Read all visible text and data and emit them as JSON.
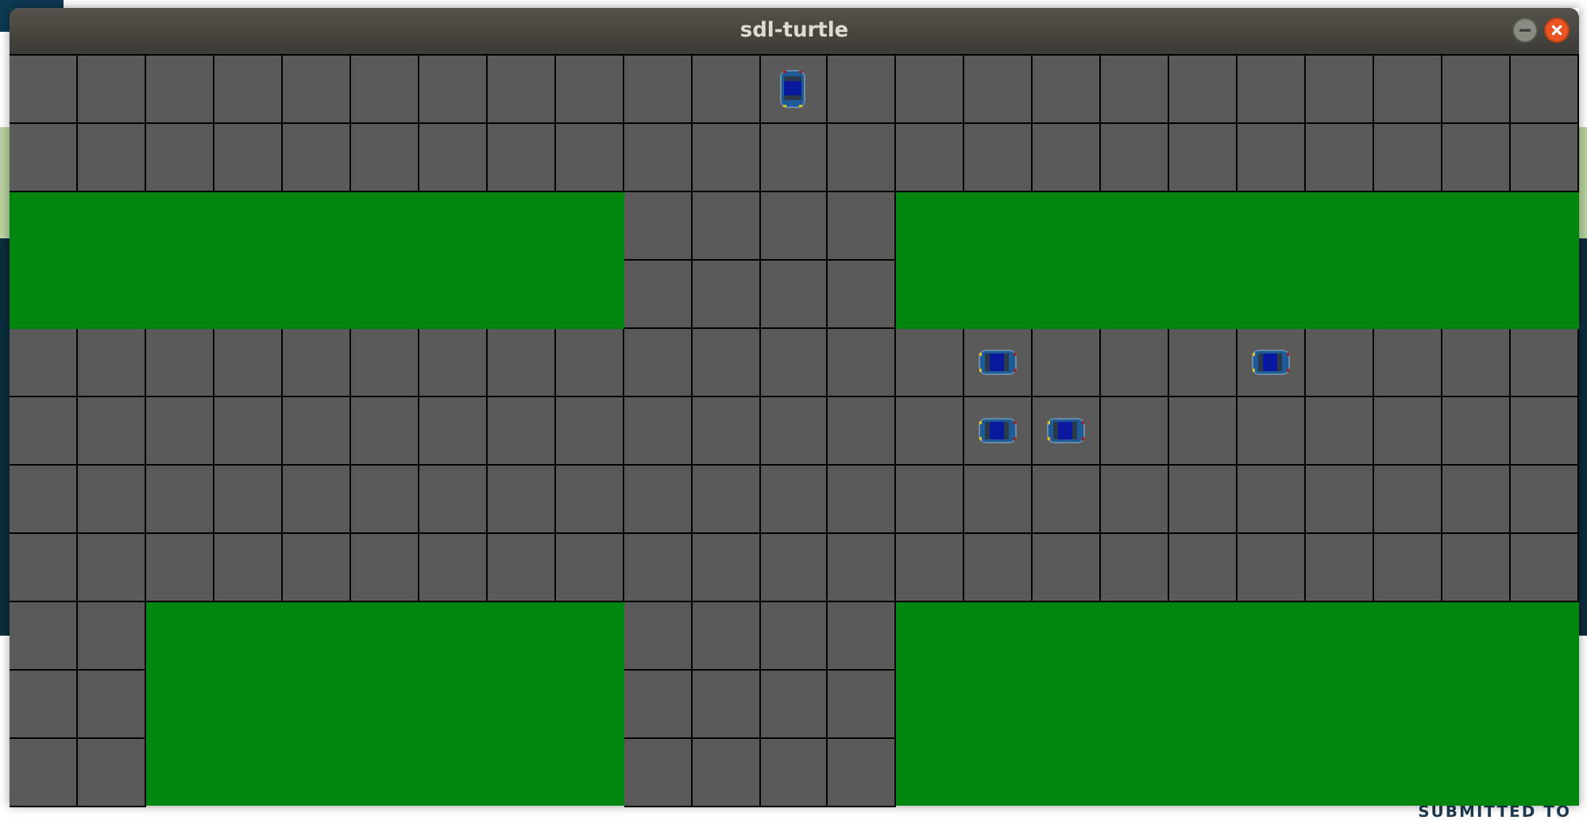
{
  "background_page": {
    "footer_label": "SUBMITTED TO"
  },
  "window": {
    "title": "sdl-turtle",
    "grid": [
      {
        "cells": [
          {
            "kind": "road"
          },
          {
            "kind": "road"
          },
          {
            "kind": "road"
          },
          {
            "kind": "road"
          },
          {
            "kind": "road"
          },
          {
            "kind": "road"
          },
          {
            "kind": "road"
          },
          {
            "kind": "road"
          },
          {
            "kind": "road"
          },
          {
            "kind": "road"
          },
          {
            "kind": "road"
          },
          {
            "kind": "car-up"
          },
          {
            "kind": "road"
          },
          {
            "kind": "road"
          },
          {
            "kind": "road"
          },
          {
            "kind": "road"
          },
          {
            "kind": "road"
          },
          {
            "kind": "road"
          },
          {
            "kind": "road"
          },
          {
            "kind": "road"
          },
          {
            "kind": "road"
          },
          {
            "kind": "road"
          },
          {
            "kind": "road"
          }
        ]
      },
      {
        "cells": [
          {
            "kind": "road"
          },
          {
            "kind": "road"
          },
          {
            "kind": "road"
          },
          {
            "kind": "road"
          },
          {
            "kind": "road"
          },
          {
            "kind": "road"
          },
          {
            "kind": "road"
          },
          {
            "kind": "road"
          },
          {
            "kind": "road"
          },
          {
            "kind": "road"
          },
          {
            "kind": "road"
          },
          {
            "kind": "road"
          },
          {
            "kind": "road"
          },
          {
            "kind": "road"
          },
          {
            "kind": "road"
          },
          {
            "kind": "road"
          },
          {
            "kind": "road"
          },
          {
            "kind": "road"
          },
          {
            "kind": "road"
          },
          {
            "kind": "road"
          },
          {
            "kind": "road"
          },
          {
            "kind": "road"
          },
          {
            "kind": "road"
          }
        ]
      },
      {
        "cells": [
          {
            "kind": "grass"
          },
          {
            "kind": "grass"
          },
          {
            "kind": "grass"
          },
          {
            "kind": "grass"
          },
          {
            "kind": "grass"
          },
          {
            "kind": "grass"
          },
          {
            "kind": "grass"
          },
          {
            "kind": "grass"
          },
          {
            "kind": "grass"
          },
          {
            "kind": "road"
          },
          {
            "kind": "road"
          },
          {
            "kind": "road"
          },
          {
            "kind": "road"
          },
          {
            "kind": "grass"
          },
          {
            "kind": "grass"
          },
          {
            "kind": "grass"
          },
          {
            "kind": "grass"
          },
          {
            "kind": "grass"
          },
          {
            "kind": "grass"
          },
          {
            "kind": "grass"
          },
          {
            "kind": "grass"
          },
          {
            "kind": "grass"
          },
          {
            "kind": "grass"
          }
        ]
      },
      {
        "cells": [
          {
            "kind": "grass"
          },
          {
            "kind": "grass"
          },
          {
            "kind": "grass"
          },
          {
            "kind": "grass"
          },
          {
            "kind": "grass"
          },
          {
            "kind": "grass"
          },
          {
            "kind": "grass"
          },
          {
            "kind": "grass"
          },
          {
            "kind": "grass"
          },
          {
            "kind": "road"
          },
          {
            "kind": "road"
          },
          {
            "kind": "road"
          },
          {
            "kind": "road"
          },
          {
            "kind": "grass"
          },
          {
            "kind": "grass"
          },
          {
            "kind": "grass"
          },
          {
            "kind": "grass"
          },
          {
            "kind": "grass"
          },
          {
            "kind": "grass"
          },
          {
            "kind": "grass"
          },
          {
            "kind": "grass"
          },
          {
            "kind": "grass"
          },
          {
            "kind": "grass"
          }
        ]
      },
      {
        "cells": [
          {
            "kind": "road"
          },
          {
            "kind": "road"
          },
          {
            "kind": "road"
          },
          {
            "kind": "road"
          },
          {
            "kind": "road"
          },
          {
            "kind": "road"
          },
          {
            "kind": "road"
          },
          {
            "kind": "road"
          },
          {
            "kind": "road"
          },
          {
            "kind": "road"
          },
          {
            "kind": "road"
          },
          {
            "kind": "road"
          },
          {
            "kind": "road"
          },
          {
            "kind": "road"
          },
          {
            "kind": "car-side"
          },
          {
            "kind": "road"
          },
          {
            "kind": "road"
          },
          {
            "kind": "road"
          },
          {
            "kind": "car-side"
          },
          {
            "kind": "road"
          },
          {
            "kind": "road"
          },
          {
            "kind": "road"
          },
          {
            "kind": "road"
          }
        ]
      },
      {
        "cells": [
          {
            "kind": "road"
          },
          {
            "kind": "road"
          },
          {
            "kind": "road"
          },
          {
            "kind": "road"
          },
          {
            "kind": "road"
          },
          {
            "kind": "road"
          },
          {
            "kind": "road"
          },
          {
            "kind": "road"
          },
          {
            "kind": "road"
          },
          {
            "kind": "road"
          },
          {
            "kind": "road"
          },
          {
            "kind": "road"
          },
          {
            "kind": "road"
          },
          {
            "kind": "road"
          },
          {
            "kind": "car-side"
          },
          {
            "kind": "car-side"
          },
          {
            "kind": "road"
          },
          {
            "kind": "road"
          },
          {
            "kind": "road"
          },
          {
            "kind": "road"
          },
          {
            "kind": "road"
          },
          {
            "kind": "road"
          },
          {
            "kind": "road"
          }
        ]
      },
      {
        "cells": [
          {
            "kind": "road"
          },
          {
            "kind": "road"
          },
          {
            "kind": "road"
          },
          {
            "kind": "road"
          },
          {
            "kind": "road"
          },
          {
            "kind": "road"
          },
          {
            "kind": "road"
          },
          {
            "kind": "road"
          },
          {
            "kind": "road"
          },
          {
            "kind": "road"
          },
          {
            "kind": "road"
          },
          {
            "kind": "road"
          },
          {
            "kind": "road"
          },
          {
            "kind": "road"
          },
          {
            "kind": "road"
          },
          {
            "kind": "road"
          },
          {
            "kind": "road"
          },
          {
            "kind": "road"
          },
          {
            "kind": "road"
          },
          {
            "kind": "road"
          },
          {
            "kind": "road"
          },
          {
            "kind": "road"
          },
          {
            "kind": "road"
          }
        ]
      },
      {
        "cells": [
          {
            "kind": "road"
          },
          {
            "kind": "road"
          },
          {
            "kind": "road"
          },
          {
            "kind": "road"
          },
          {
            "kind": "road"
          },
          {
            "kind": "road"
          },
          {
            "kind": "road"
          },
          {
            "kind": "road"
          },
          {
            "kind": "road"
          },
          {
            "kind": "road"
          },
          {
            "kind": "road"
          },
          {
            "kind": "road"
          },
          {
            "kind": "road"
          },
          {
            "kind": "road"
          },
          {
            "kind": "road"
          },
          {
            "kind": "road"
          },
          {
            "kind": "road"
          },
          {
            "kind": "road"
          },
          {
            "kind": "road"
          },
          {
            "kind": "road"
          },
          {
            "kind": "road"
          },
          {
            "kind": "road"
          },
          {
            "kind": "road"
          }
        ]
      },
      {
        "cells": [
          {
            "kind": "road"
          },
          {
            "kind": "road"
          },
          {
            "kind": "grass"
          },
          {
            "kind": "grass"
          },
          {
            "kind": "grass"
          },
          {
            "kind": "grass"
          },
          {
            "kind": "grass"
          },
          {
            "kind": "grass"
          },
          {
            "kind": "grass"
          },
          {
            "kind": "road"
          },
          {
            "kind": "road"
          },
          {
            "kind": "road"
          },
          {
            "kind": "road"
          },
          {
            "kind": "grass"
          },
          {
            "kind": "grass"
          },
          {
            "kind": "grass"
          },
          {
            "kind": "grass"
          },
          {
            "kind": "grass"
          },
          {
            "kind": "grass"
          },
          {
            "kind": "grass"
          },
          {
            "kind": "grass"
          },
          {
            "kind": "grass"
          },
          {
            "kind": "grass"
          }
        ]
      },
      {
        "cells": [
          {
            "kind": "road"
          },
          {
            "kind": "road"
          },
          {
            "kind": "grass"
          },
          {
            "kind": "grass"
          },
          {
            "kind": "grass"
          },
          {
            "kind": "grass"
          },
          {
            "kind": "grass"
          },
          {
            "kind": "grass"
          },
          {
            "kind": "grass"
          },
          {
            "kind": "road"
          },
          {
            "kind": "road"
          },
          {
            "kind": "road"
          },
          {
            "kind": "road"
          },
          {
            "kind": "grass"
          },
          {
            "kind": "grass"
          },
          {
            "kind": "grass"
          },
          {
            "kind": "grass"
          },
          {
            "kind": "grass"
          },
          {
            "kind": "grass"
          },
          {
            "kind": "grass"
          },
          {
            "kind": "grass"
          },
          {
            "kind": "grass"
          },
          {
            "kind": "grass"
          }
        ]
      },
      {
        "cells": [
          {
            "kind": "road"
          },
          {
            "kind": "road"
          },
          {
            "kind": "grass"
          },
          {
            "kind": "grass"
          },
          {
            "kind": "grass"
          },
          {
            "kind": "grass"
          },
          {
            "kind": "grass"
          },
          {
            "kind": "grass"
          },
          {
            "kind": "grass"
          },
          {
            "kind": "road"
          },
          {
            "kind": "road"
          },
          {
            "kind": "road"
          },
          {
            "kind": "road"
          },
          {
            "kind": "grass"
          },
          {
            "kind": "grass"
          },
          {
            "kind": "grass"
          },
          {
            "kind": "grass"
          },
          {
            "kind": "grass"
          },
          {
            "kind": "grass"
          },
          {
            "kind": "grass"
          },
          {
            "kind": "grass"
          },
          {
            "kind": "grass"
          },
          {
            "kind": "grass"
          }
        ]
      }
    ]
  }
}
